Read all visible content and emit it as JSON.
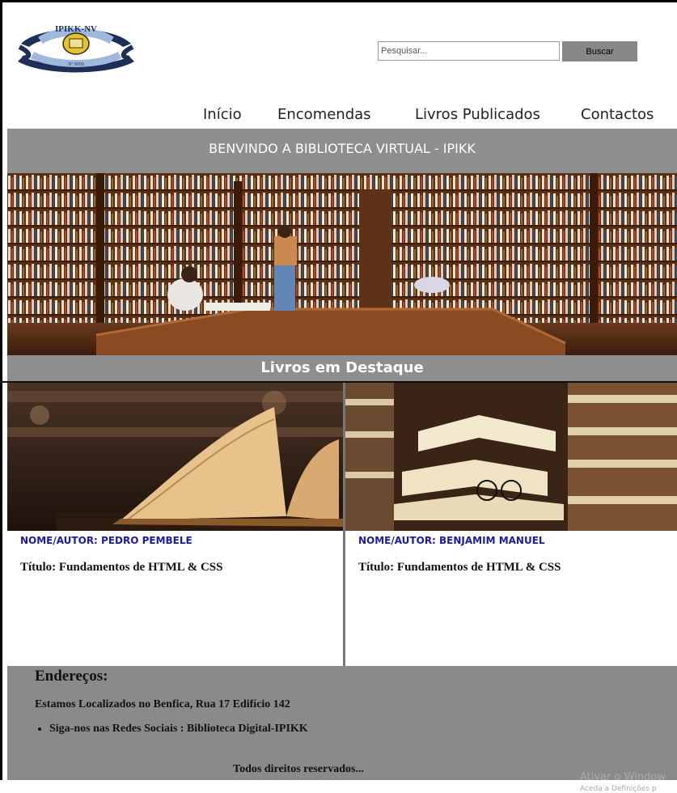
{
  "search": {
    "placeholder": "Pesquisar...",
    "button_label": "Buscar"
  },
  "nav": {
    "items": [
      "Início",
      "Encomendas",
      "Livros Publicados",
      "Contactos"
    ]
  },
  "banner": {
    "text": "BENVINDO A BIBLIOTECA VIRTUAL - IPIKK"
  },
  "featured": {
    "heading": "Livros em Destaque"
  },
  "books": [
    {
      "author": "NOME/AUTOR: PEDRO PEMBELE",
      "title": "Título: Fundamentos de HTML & CSS"
    },
    {
      "author": "NOME/AUTOR: BENJAMIM MANUEL",
      "title": "Título: Fundamentos de HTML & CSS"
    }
  ],
  "footer": {
    "heading": "Endereços:",
    "location": "Estamos Localizados no Benfica, Rua 17 Edifício 142",
    "social": "Siga-nos nas Redes Sociais : Biblioteca Digital-IPIKK",
    "rights": "Todos direitos reservados...",
    "watermark_title": "Ativar o Window",
    "watermark_sub": "Aceda a Definições p"
  },
  "logo": {
    "text": "IPIKK-NV",
    "number": "Nº 8056"
  }
}
